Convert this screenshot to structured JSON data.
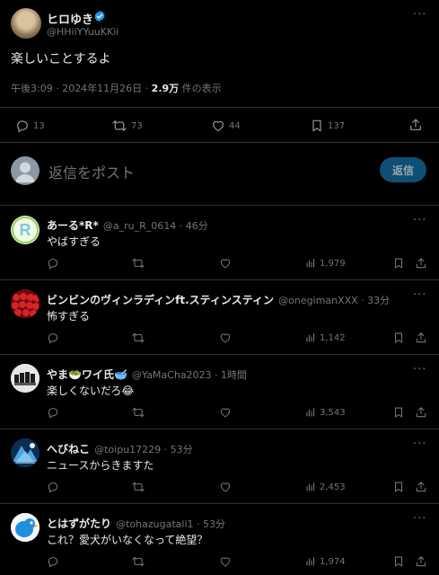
{
  "tweet": {
    "author_name": "ヒロゆき",
    "author_handle": "@HHiiYYuuKKii",
    "text": "楽しいことするよ",
    "timestamp": "午後3:09 · 2024年11月26日 · ",
    "views_count": "2.9万",
    "views_suffix": " 件の表示",
    "more_label": "···",
    "actions": {
      "replies": "13",
      "retweets": "73",
      "likes": "44",
      "bookmarks": "137"
    }
  },
  "composer": {
    "placeholder": "返信をポスト",
    "button_label": "返信"
  },
  "replies": [
    {
      "name": "あーる*R*",
      "handle": "@a_ru_R_0614 · 46分",
      "text": "やばすぎる",
      "views": "1,979",
      "more": "···"
    },
    {
      "name": "ビンビンのヴィンラディンft.スティンスティン",
      "handle": "@onegimanXXX · 33分",
      "text": "怖すぎる",
      "views": "1,142",
      "more": "···"
    },
    {
      "name": "やま🥗ワイ氏🥣",
      "handle": "@YaMaCha2023 · 1時間",
      "text": "楽しくないだろ😂",
      "views": "3,543",
      "more": "···"
    },
    {
      "name": "へびねこ",
      "handle": "@toipu17229 · 53分",
      "text": "ニュースからきますた",
      "views": "2,453",
      "more": "···"
    },
    {
      "name": "とはずがたり",
      "handle": "@tohazugatali1 · 53分",
      "text": "これ？愛犬がいなくなって絶望？",
      "views": "1,974",
      "more": "···"
    }
  ],
  "colors": {
    "background": "#000000",
    "text": "#e7e9ea",
    "muted": "#71767b",
    "divider": "#2f3336",
    "verified": "#1d9bf0",
    "reply_button_bg": "#0f4e75"
  }
}
